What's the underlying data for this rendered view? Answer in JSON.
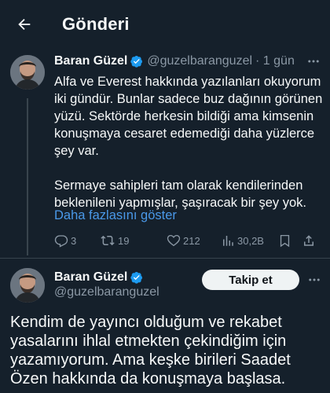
{
  "header": {
    "title": "Gönderi"
  },
  "reply_tweet": {
    "author_name": "Baran Güzel",
    "handle": "@guzelbaranguzel",
    "time": "· 1 gün",
    "paragraphs": [
      "Alfa ve Everest hakkında yazılanları okuyorum iki gündür. Bunlar sadece buz dağının görünen yüzü. Sektörde herkesin bildiği ama kimsenin konuşmaya cesaret edemediği daha yüzlerce şey var.",
      "Sermaye sahipleri tam olarak kendilerinden beklenileni yapmışlar, şaşıracak bir şey yok."
    ],
    "show_more": "Daha fazlasını göster",
    "replies": "3",
    "retweets": "19",
    "likes": "212",
    "views": "30,2B"
  },
  "main_tweet": {
    "author_name": "Baran Güzel",
    "handle": "@guzelbaranguzel",
    "follow_label": "Takip et",
    "text": "Kendim de yayıncı olduğum ve rekabet yasalarını ihlal etmekten çekindiğim için yazamıyorum. Ama keşke birileri Saadet Özen hakkında da konuşmaya başlasa."
  },
  "colors": {
    "background": "#15202b",
    "accent": "#4a99e9",
    "secondary_text": "#8b98a5",
    "verified": "#1d9bf0"
  },
  "icons": [
    "back-arrow-icon",
    "verified-icon",
    "more-icon",
    "reply-icon",
    "retweet-icon",
    "like-icon",
    "views-icon",
    "bookmark-icon",
    "share-icon"
  ]
}
